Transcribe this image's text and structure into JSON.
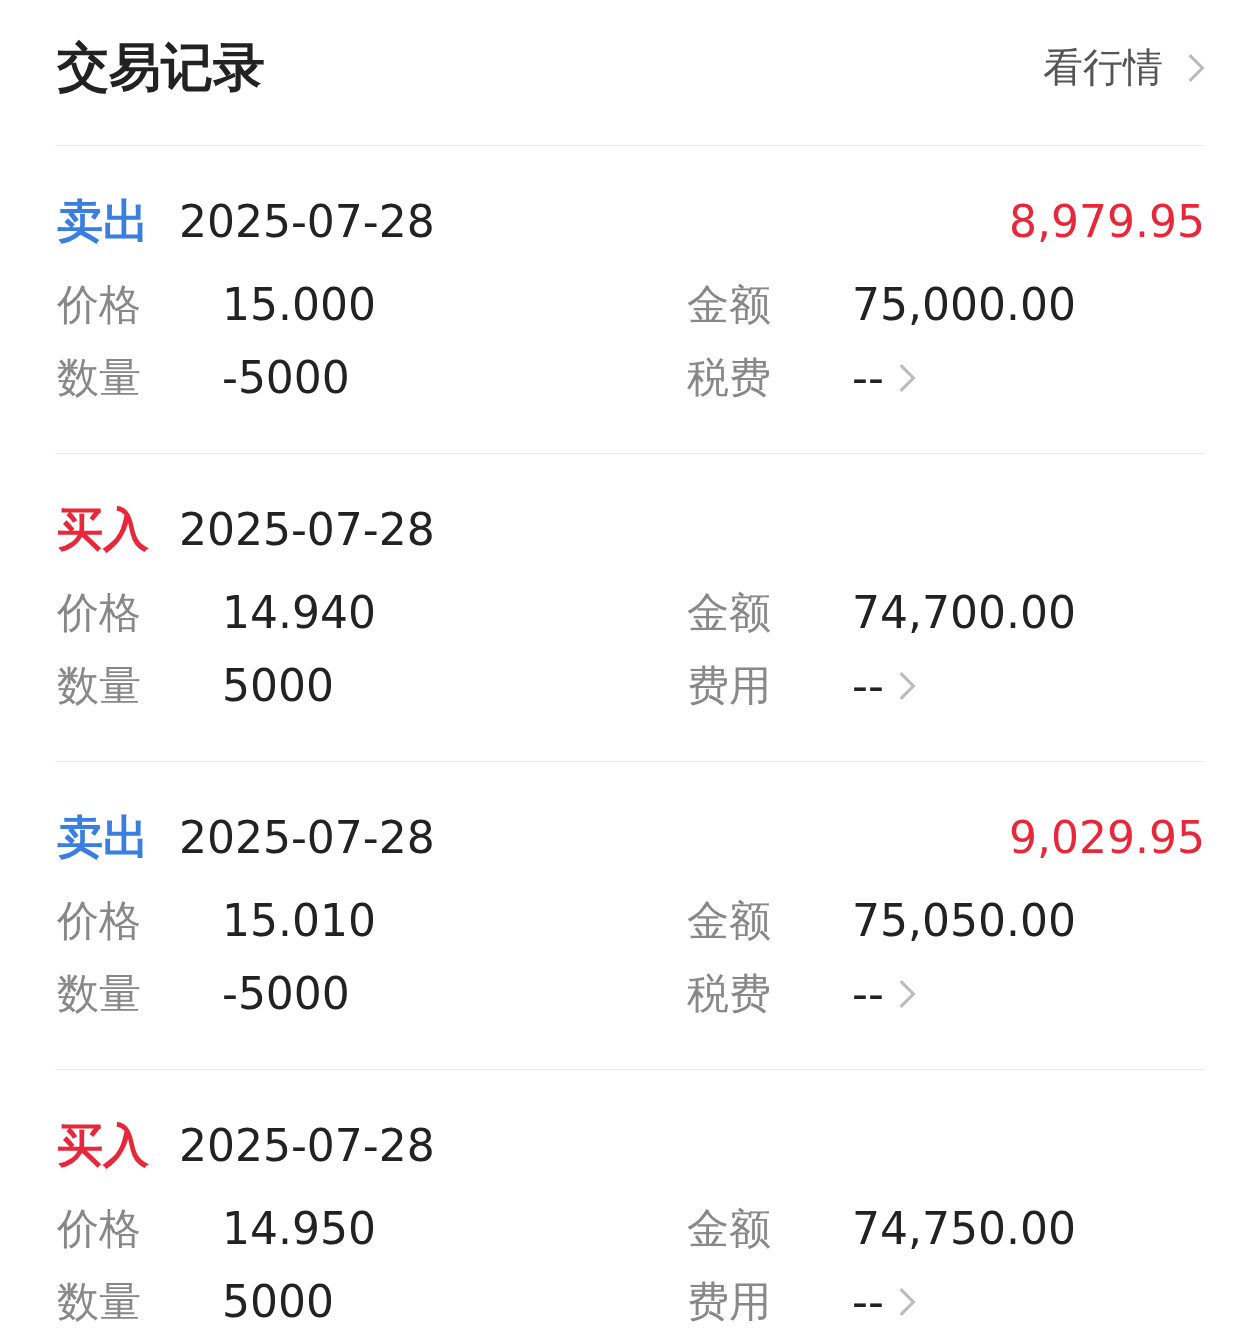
{
  "header": {
    "title": "交易记录",
    "link": "看行情"
  },
  "records": [
    {
      "kind": "sell",
      "type": "卖出",
      "date": "2025-07-28",
      "profit": "8,979.95",
      "price_label": "价格",
      "price": "15.000",
      "amount_label": "金额",
      "amount": "75,000.00",
      "qty_label": "数量",
      "qty": "-5000",
      "fee_label": "税费",
      "fee": "--"
    },
    {
      "kind": "buy",
      "type": "买入",
      "date": "2025-07-28",
      "price_label": "价格",
      "price": "14.940",
      "amount_label": "金额",
      "amount": "74,700.00",
      "qty_label": "数量",
      "qty": "5000",
      "fee_label": "费用",
      "fee": "--"
    },
    {
      "kind": "sell",
      "type": "卖出",
      "date": "2025-07-28",
      "profit": "9,029.95",
      "price_label": "价格",
      "price": "15.010",
      "amount_label": "金额",
      "amount": "75,050.00",
      "qty_label": "数量",
      "qty": "-5000",
      "fee_label": "税费",
      "fee": "--"
    },
    {
      "kind": "buy",
      "type": "买入",
      "date": "2025-07-28",
      "price_label": "价格",
      "price": "14.950",
      "amount_label": "金额",
      "amount": "74,750.00",
      "qty_label": "数量",
      "qty": "5000",
      "fee_label": "费用",
      "fee": "--"
    }
  ]
}
